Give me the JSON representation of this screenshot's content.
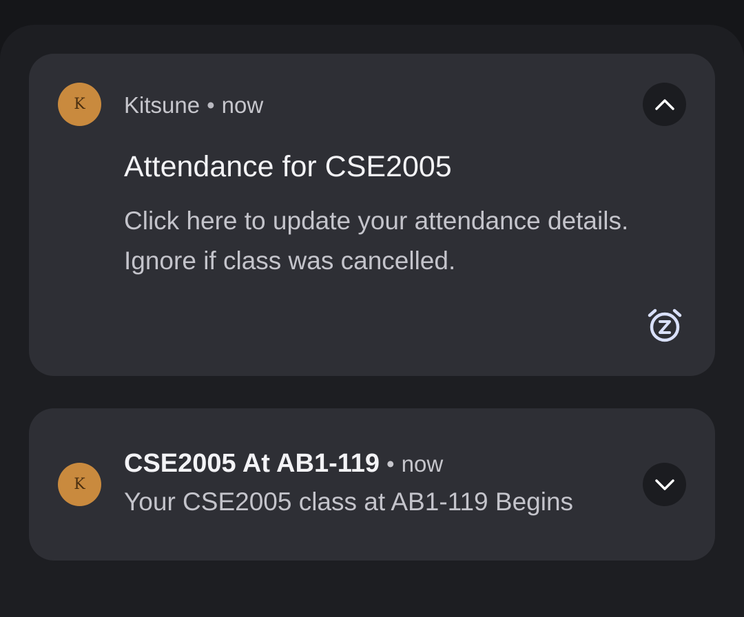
{
  "notifications": [
    {
      "app_initial": "K",
      "app_name": "Kitsune",
      "time": "now",
      "title": "Attendance for CSE2005",
      "body_line1": "Click here to update your attendance details.",
      "body_line2": "Ignore if class was cancelled.",
      "expand_icon": "chevron-up-icon",
      "snooze_icon": "snooze-alarm-icon",
      "expanded": true
    },
    {
      "app_initial": "K",
      "title": "CSE2005 At AB1-119",
      "time": "now",
      "preview": "Your CSE2005 class at AB1-119 Begins",
      "expand_icon": "chevron-down-icon",
      "expanded": false
    }
  ],
  "colors": {
    "avatar": "#c98a3e",
    "card": "#2e2f35",
    "shade": "#1d1e22",
    "snooze_accent": "#d9e0fb"
  }
}
